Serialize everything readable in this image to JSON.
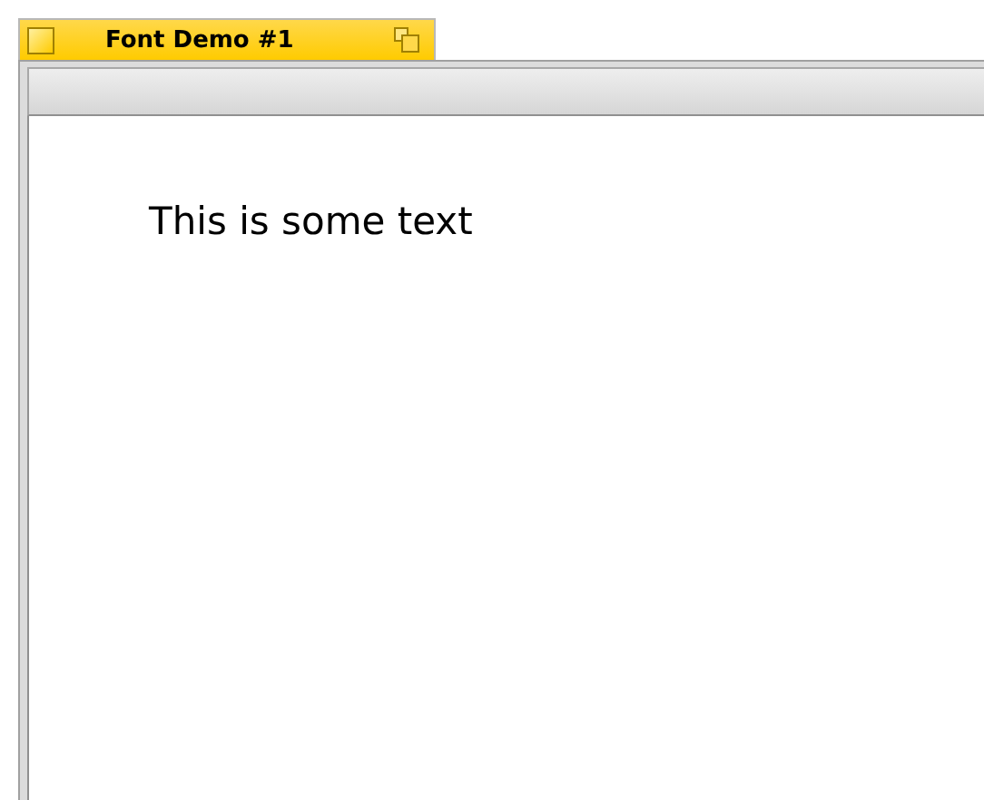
{
  "window": {
    "title": "Font Demo #1"
  },
  "content": {
    "text": "This is some text"
  }
}
